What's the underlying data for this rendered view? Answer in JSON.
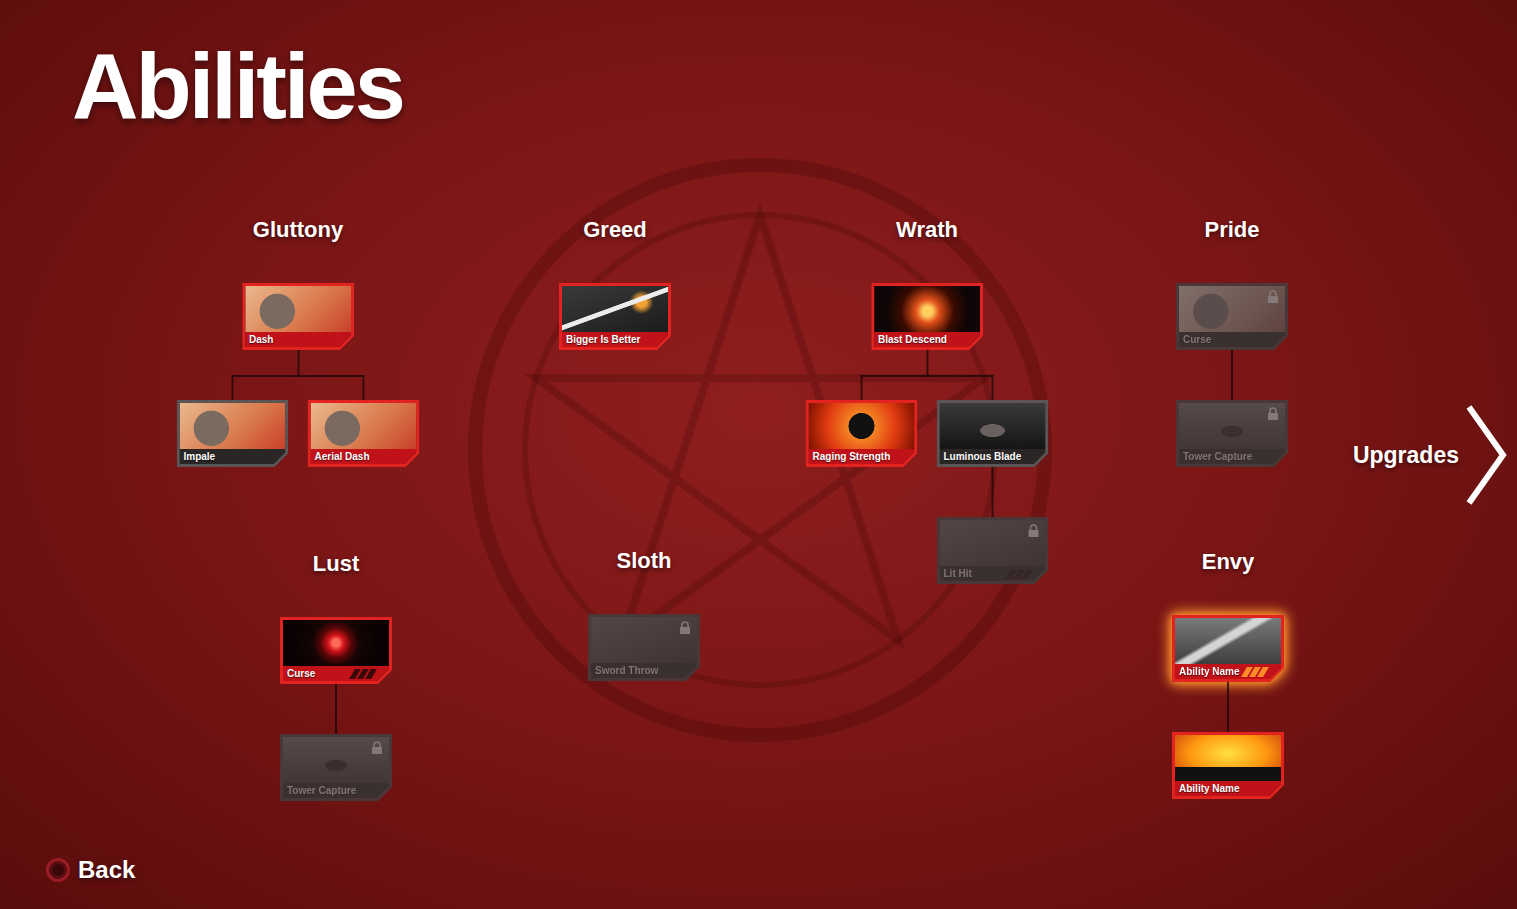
{
  "screen": {
    "title": "Abilities"
  },
  "trees": [
    {
      "title": "Gluttony",
      "nodes": [
        {
          "label": "Dash",
          "equipped": true,
          "locked": false,
          "selected": false,
          "children": [
            {
              "label": "Impale",
              "equipped": false,
              "locked": false,
              "selected": false,
              "children": []
            },
            {
              "label": "Aerial Dash",
              "equipped": true,
              "locked": false,
              "selected": false,
              "children": []
            }
          ]
        }
      ]
    },
    {
      "title": "Greed",
      "nodes": [
        {
          "label": "Bigger Is Better",
          "equipped": true,
          "locked": false,
          "selected": false,
          "children": []
        }
      ]
    },
    {
      "title": "Wrath",
      "nodes": [
        {
          "label": "Blast Descend",
          "equipped": true,
          "locked": false,
          "selected": false,
          "children": [
            {
              "label": "Raging Strength",
              "equipped": true,
              "locked": false,
              "selected": false,
              "children": []
            },
            {
              "label": "Luminous Blade",
              "equipped": false,
              "locked": false,
              "selected": false,
              "children": [
                {
                  "label": "Lit Hit",
                  "equipped": false,
                  "locked": true,
                  "selected": false,
                  "charges": 0,
                  "children": []
                }
              ]
            }
          ]
        }
      ]
    },
    {
      "title": "Pride",
      "nodes": [
        {
          "label": "Curse",
          "equipped": false,
          "locked": true,
          "selected": false,
          "children": [
            {
              "label": "Tower Capture",
              "equipped": false,
              "locked": true,
              "selected": false,
              "children": []
            }
          ]
        }
      ]
    },
    {
      "title": "Lust",
      "nodes": [
        {
          "label": "Curse",
          "equipped": true,
          "locked": false,
          "selected": false,
          "charges": 0,
          "children": [
            {
              "label": "Tower Capture",
              "equipped": false,
              "locked": true,
              "selected": false,
              "children": []
            }
          ]
        }
      ]
    },
    {
      "title": "Sloth",
      "nodes": [
        {
          "label": "Sword Throw",
          "equipped": false,
          "locked": true,
          "selected": false,
          "children": []
        }
      ]
    },
    {
      "title": "Envy",
      "nodes": [
        {
          "label": "Ability Name",
          "equipped": true,
          "locked": false,
          "selected": true,
          "charges": 3,
          "children": [
            {
              "label": "Ability Name",
              "equipped": true,
              "locked": false,
              "selected": false,
              "children": []
            }
          ]
        }
      ]
    }
  ],
  "navigation": {
    "next": {
      "label": "Upgrades"
    },
    "back": {
      "label": "Back"
    }
  }
}
